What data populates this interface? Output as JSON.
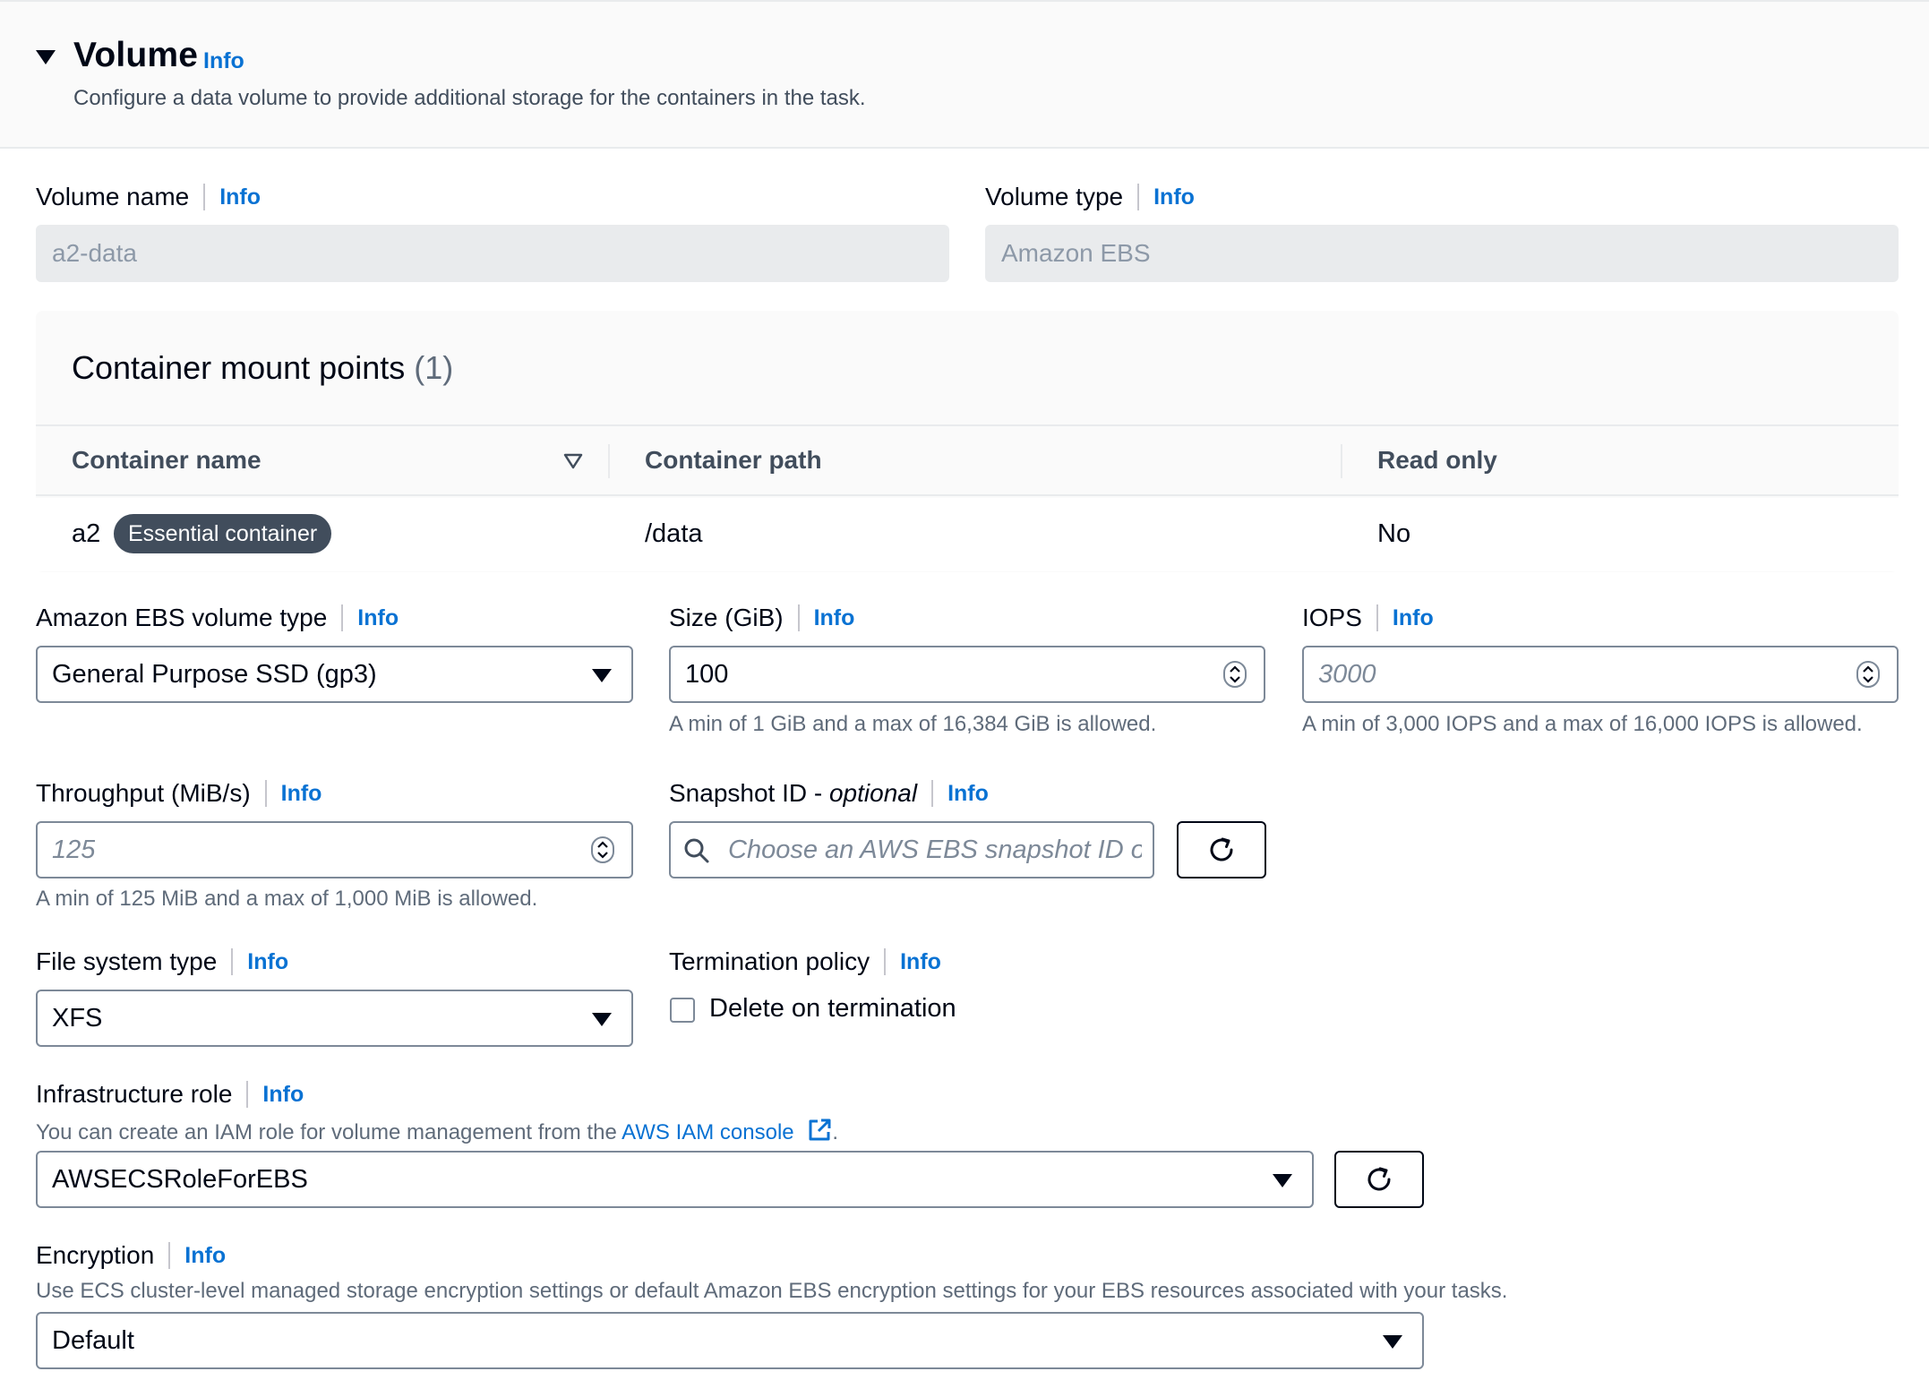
{
  "header": {
    "title": "Volume",
    "info": "Info",
    "description": "Configure a data volume to provide additional storage for the containers in the task."
  },
  "volume_name": {
    "label": "Volume name",
    "info": "Info",
    "value": "a2-data"
  },
  "volume_type": {
    "label": "Volume type",
    "info": "Info",
    "value": "Amazon EBS"
  },
  "mount_points": {
    "title": "Container mount points",
    "count": "(1)",
    "columns": [
      "Container name",
      "Container path",
      "Read only"
    ],
    "rows": [
      {
        "container_name": "a2",
        "badge": "Essential container",
        "path": "/data",
        "read_only": "No"
      }
    ]
  },
  "ebs_volume_type": {
    "label": "Amazon EBS volume type",
    "info": "Info",
    "value": "General Purpose SSD (gp3)"
  },
  "size": {
    "label": "Size (GiB)",
    "info": "Info",
    "value": "100",
    "hint": "A min of 1 GiB and a max of 16,384 GiB is allowed."
  },
  "iops": {
    "label": "IOPS",
    "info": "Info",
    "placeholder": "3000",
    "hint": "A min of 3,000 IOPS and a max of 16,000 IOPS is allowed."
  },
  "throughput": {
    "label": "Throughput (MiB/s)",
    "info": "Info",
    "placeholder": "125",
    "hint": "A min of 125 MiB and a max of 1,000 MiB is allowed."
  },
  "snapshot": {
    "label_main": "Snapshot ID - ",
    "label_optional": "optional",
    "info": "Info",
    "placeholder": "Choose an AWS EBS snapshot ID or e"
  },
  "file_system_type": {
    "label": "File system type",
    "info": "Info",
    "value": "XFS"
  },
  "termination_policy": {
    "label": "Termination policy",
    "info": "Info",
    "checkbox_label": "Delete on termination",
    "checked": false
  },
  "infrastructure_role": {
    "label": "Infrastructure role",
    "info": "Info",
    "hint_prefix": "You can create an IAM role for volume management from the ",
    "hint_link": "AWS IAM console",
    "hint_suffix": ".",
    "value": "AWSECSRoleForEBS"
  },
  "encryption": {
    "label": "Encryption",
    "info": "Info",
    "hint": "Use ECS cluster-level managed storage encryption settings or default Amazon EBS encryption settings for your EBS resources associated with your tasks.",
    "value": "Default"
  },
  "colors": {
    "link": "#0972d3",
    "text": "#000716",
    "muted": "#5f6b7a",
    "badge": "#414d5c",
    "readonly_bg": "#e9ebed"
  }
}
